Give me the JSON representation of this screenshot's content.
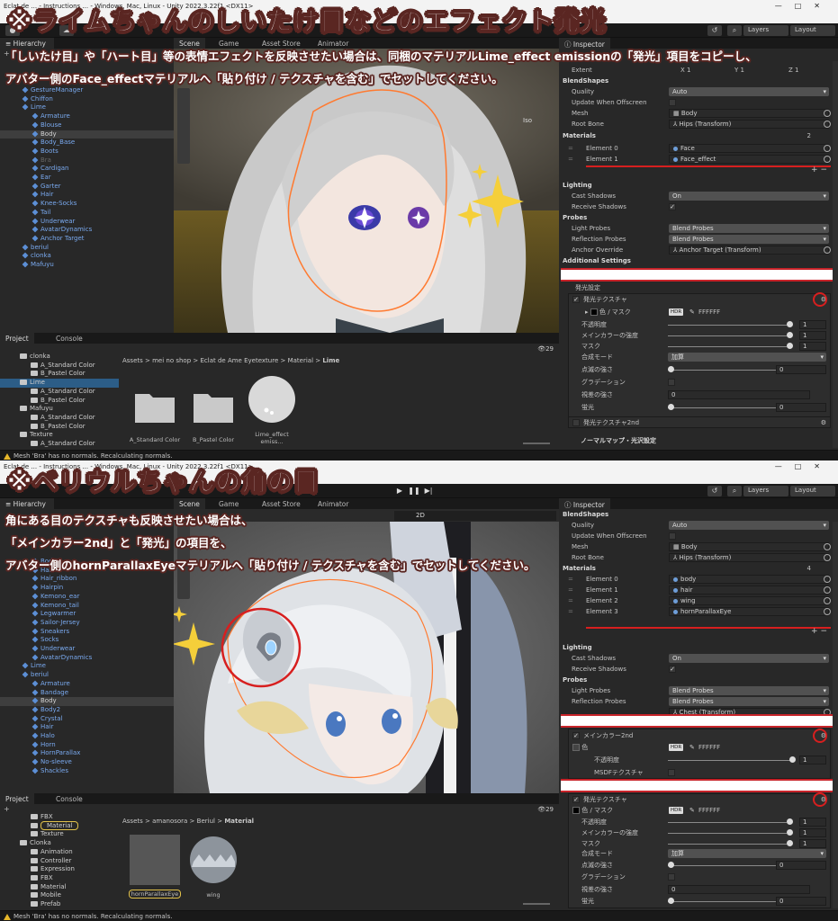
{
  "shot1": {
    "headline": "※ライムちゃんのしいたけ目などのエフェクト発光",
    "note_line1": "「しいたけ目」や「ハート目」等の表情エフェクトを反映させたい場合は、同梱のマテリアルLime_effect emissionの「発光」項目をコピーし、",
    "note_line2": "アバター側のFace_effectマテリアルへ「貼り付け / テクスチャを含む」でセットしてください。",
    "window_title": "Eclat de ... - Instructions ... - Windows, Mac, Linux - Unity 2022.3.22f1 <DX11>",
    "hierarchy": {
      "tab": "Hierarchy",
      "rows": [
        {
          "label": "GestureManager",
          "indent": 1,
          "style": "blue"
        },
        {
          "label": "Chiffon",
          "indent": 1,
          "style": "blue"
        },
        {
          "label": "Lime",
          "indent": 1,
          "style": "blue"
        },
        {
          "label": "Armature",
          "indent": 2,
          "style": "blue"
        },
        {
          "label": "Blouse",
          "indent": 2,
          "style": "blue"
        },
        {
          "label": "Body",
          "indent": 2,
          "style": "blue",
          "selected": true
        },
        {
          "label": "Body_Base",
          "indent": 2,
          "style": "blue"
        },
        {
          "label": "Boots",
          "indent": 2,
          "style": "blue"
        },
        {
          "label": "Bra",
          "indent": 2,
          "style": "gray"
        },
        {
          "label": "Cardigan",
          "indent": 2,
          "style": "blue"
        },
        {
          "label": "Ear",
          "indent": 2,
          "style": "blue"
        },
        {
          "label": "Garter",
          "indent": 2,
          "style": "blue"
        },
        {
          "label": "Hair",
          "indent": 2,
          "style": "blue"
        },
        {
          "label": "Knee-Socks",
          "indent": 2,
          "style": "blue"
        },
        {
          "label": "Tail",
          "indent": 2,
          "style": "blue"
        },
        {
          "label": "Underwear",
          "indent": 2,
          "style": "blue"
        },
        {
          "label": "AvatarDynamics",
          "indent": 2,
          "style": "blue"
        },
        {
          "label": "Anchor Target",
          "indent": 2,
          "style": "blue"
        },
        {
          "label": "beriul",
          "indent": 1,
          "style": "blue"
        },
        {
          "label": "clonka",
          "indent": 1,
          "style": "blue"
        },
        {
          "label": "Mafuyu",
          "indent": 1,
          "style": "blue"
        }
      ]
    },
    "scene_tabs": [
      "Scene",
      "Game",
      "Asset Store",
      "Animator"
    ],
    "scene_persp": "Iso",
    "project": {
      "tabs": [
        "Project",
        "Console"
      ],
      "tree": [
        {
          "label": "clonka",
          "indent": 1
        },
        {
          "label": "A_Standard Color",
          "indent": 2
        },
        {
          "label": "B_Pastel Color",
          "indent": 2
        },
        {
          "label": "Lime",
          "indent": 1,
          "selected": true
        },
        {
          "label": "A_Standard Color",
          "indent": 2
        },
        {
          "label": "B_Pastel Color",
          "indent": 2
        },
        {
          "label": "Mafuyu",
          "indent": 1
        },
        {
          "label": "A_Standard Color",
          "indent": 2
        },
        {
          "label": "B_Pastel Color",
          "indent": 2
        },
        {
          "label": "Texture",
          "indent": 1
        },
        {
          "label": "A_Standard Color",
          "indent": 2
        }
      ],
      "breadcrumb": [
        "Assets",
        "mei no shop",
        "Eclat de Ame Eyetexture",
        "Material",
        "Lime"
      ],
      "assets": [
        "A_Standard Color",
        "B_Pastel Color",
        "Lime_effect emiss..."
      ],
      "count": "29"
    },
    "inspector": {
      "tab": "Inspector",
      "extent_label": "Extent",
      "extent_x": "X  1",
      "extent_y": "Y  1",
      "extent_z": "Z  1",
      "blendshapes": "BlendShapes",
      "quality_label": "Quality",
      "quality_value": "Auto",
      "update_offscreen": "Update When Offscreen",
      "mesh_label": "Mesh",
      "mesh_value": "Body",
      "rootbone_label": "Root Bone",
      "rootbone_value": "Hips (Transform)",
      "materials_label": "Materials",
      "materials_count": "2",
      "elements": [
        {
          "label": "Element 0",
          "value": "Face"
        },
        {
          "label": "Element 1",
          "value": "Face_effect"
        }
      ],
      "lighting": "Lighting",
      "cast_shadows_label": "Cast Shadows",
      "cast_shadows_value": "On",
      "receive_shadows_label": "Receive Shadows",
      "probes": "Probes",
      "light_probes_label": "Light Probes",
      "light_probes_value": "Blend Probes",
      "reflection_probes_label": "Reflection Probes",
      "reflection_probes_value": "Blend Probes",
      "anchor_override_label": "Anchor Override",
      "anchor_override_value": "Anchor Target (Transform)",
      "additional": "Additional Settings",
      "emission_section": "発光設定",
      "emission_tex": "発光テクスチャ",
      "color_mask_label": "色 / マスク",
      "hdr": "HDR",
      "color_hex": "FFFFFF",
      "sliders": [
        {
          "label": "不透明度",
          "value": "1",
          "level": 1
        },
        {
          "label": "メインカラーの強度",
          "value": "1",
          "level": 1
        },
        {
          "label": "マスク",
          "value": "1",
          "level": 1
        }
      ],
      "blend_mode_label": "合成モード",
      "blend_mode_value": "加算",
      "blink_label": "点滅の強さ",
      "blink_value": "0",
      "gradation_label": "グラデーション",
      "parallax_label": "視差の強さ",
      "parallax_value": "0",
      "fluorescence_label": "蛍光",
      "fluorescence_value": "0",
      "emission_tex2": "発光テクスチャ2nd",
      "normalmap": "ノーマルマップ・光沢設定"
    },
    "status": "Mesh 'Bra' has no normals. Recalculating normals.",
    "toolbar_layers": "Layers",
    "toolbar_layout": "Layout"
  },
  "shot2": {
    "headline": "※ベリウルちゃんの角の目",
    "note_line1": "角にある目のテクスチャも反映させたい場合は、",
    "note_line2": "「メインカラー2nd」と「発光」の項目を、",
    "note_line3": "アバター側のhornParallaxEyeマテリアルへ「貼り付け / テクスチャを含む」でセットしてください。",
    "window_title": "Eclat de ... - Instructions ... - Windows, Mac, Linux - Unity 2022.3.22f1 <DX11>",
    "hierarchy": {
      "tab": "Hierarchy",
      "rows": [
        {
          "label": "Body",
          "indent": 2,
          "style": "blue"
        },
        {
          "label": "Hair",
          "indent": 2,
          "style": "blue"
        },
        {
          "label": "Hair_ribbon",
          "indent": 2,
          "style": "blue"
        },
        {
          "label": "Hairpin",
          "indent": 2,
          "style": "blue"
        },
        {
          "label": "Kemono_ear",
          "indent": 2,
          "style": "blue"
        },
        {
          "label": "Kemono_tail",
          "indent": 2,
          "style": "blue"
        },
        {
          "label": "Legwarmer",
          "indent": 2,
          "style": "blue"
        },
        {
          "label": "Sailor-Jersey",
          "indent": 2,
          "style": "blue"
        },
        {
          "label": "Sneakers",
          "indent": 2,
          "style": "blue"
        },
        {
          "label": "Socks",
          "indent": 2,
          "style": "blue"
        },
        {
          "label": "Underwear",
          "indent": 2,
          "style": "blue"
        },
        {
          "label": "AvatarDynamics",
          "indent": 2,
          "style": "blue"
        },
        {
          "label": "Lime",
          "indent": 1,
          "style": "blue"
        },
        {
          "label": "beriul",
          "indent": 1,
          "style": "blue"
        },
        {
          "label": "Armature",
          "indent": 2,
          "style": "blue"
        },
        {
          "label": "Bandage",
          "indent": 2,
          "style": "blue"
        },
        {
          "label": "Body",
          "indent": 2,
          "style": "blue",
          "selected": true
        },
        {
          "label": "Body2",
          "indent": 2,
          "style": "blue"
        },
        {
          "label": "Crystal",
          "indent": 2,
          "style": "blue"
        },
        {
          "label": "Hair",
          "indent": 2,
          "style": "blue"
        },
        {
          "label": "Halo",
          "indent": 2,
          "style": "blue"
        },
        {
          "label": "Horn",
          "indent": 2,
          "style": "blue"
        },
        {
          "label": "HornParallax",
          "indent": 2,
          "style": "blue"
        },
        {
          "label": "No-sleeve",
          "indent": 2,
          "style": "blue"
        },
        {
          "label": "Shackles",
          "indent": 2,
          "style": "blue"
        }
      ]
    },
    "scene_tabs": [
      "Scene",
      "Game",
      "Asset Store",
      "Animator"
    ],
    "scene_2d": "2D",
    "project": {
      "tabs": [
        "Project",
        "Console"
      ],
      "tree": [
        {
          "label": "FBX",
          "indent": 2
        },
        {
          "label": "Material",
          "indent": 2,
          "highlight": true
        },
        {
          "label": "Texture",
          "indent": 2
        },
        {
          "label": "Clonka",
          "indent": 1
        },
        {
          "label": "Animation",
          "indent": 2
        },
        {
          "label": "Controller",
          "indent": 2
        },
        {
          "label": "Expression",
          "indent": 2
        },
        {
          "label": "FBX",
          "indent": 2
        },
        {
          "label": "Material",
          "indent": 2
        },
        {
          "label": "Mobile",
          "indent": 2
        },
        {
          "label": "Prefab",
          "indent": 2
        }
      ],
      "breadcrumb": [
        "Assets",
        "amanosora",
        "Beriul",
        "Material"
      ],
      "assets": [
        "hornParallaxEye",
        "wing"
      ],
      "count": "29"
    },
    "inspector": {
      "tab": "Inspector",
      "blendshapes": "BlendShapes",
      "quality_label": "Quality",
      "quality_value": "Auto",
      "update_offscreen": "Update When Offscreen",
      "mesh_label": "Mesh",
      "mesh_value": "Body",
      "rootbone_label": "Root Bone",
      "rootbone_value": "Hips (Transform)",
      "materials_label": "Materials",
      "materials_count": "4",
      "elements": [
        {
          "label": "Element 0",
          "value": "body"
        },
        {
          "label": "Element 1",
          "value": "hair"
        },
        {
          "label": "Element 2",
          "value": "wing"
        },
        {
          "label": "Element 3",
          "value": "hornParallaxEye"
        }
      ],
      "lighting": "Lighting",
      "cast_shadows_label": "Cast Shadows",
      "cast_shadows_value": "On",
      "receive_shadows_label": "Receive Shadows",
      "probes": "Probes",
      "light_probes_label": "Light Probes",
      "light_probes_value": "Blend Probes",
      "reflection_probes_label": "Reflection Probes",
      "reflection_probes_value": "Blend Probes",
      "anchor_override_value": "Chest (Transform)",
      "maincolor2": "メインカラー2nd",
      "color_label": "色",
      "hdr": "HDR",
      "color_hex": "FFFFFF",
      "opacity_label": "不透明度",
      "opacity_value": "1",
      "msdf_label": "MSDFテクスチャ",
      "emission_tex": "発光テクスチャ",
      "color_mask_label": "色 / マスク",
      "sliders": [
        {
          "label": "不透明度",
          "value": "1",
          "level": 1
        },
        {
          "label": "メインカラーの強度",
          "value": "1",
          "level": 1
        },
        {
          "label": "マスク",
          "value": "1",
          "level": 1
        }
      ],
      "blend_mode_label": "合成モード",
      "blend_mode_value": "加算",
      "blink_label": "点滅の強さ",
      "blink_value": "0",
      "gradation_label": "グラデーション",
      "parallax_label": "視差の強さ",
      "parallax_value": "0",
      "fluorescence_label": "蛍光",
      "fluorescence_value": "0"
    },
    "status": "Mesh 'Bra' has no normals. Recalculating normals.",
    "toolbar_layers": "Layers",
    "toolbar_layout": "Layout"
  },
  "colors": {
    "accent_red": "#d71f1f",
    "headline_outline": "#5a2622",
    "unity_blue_text": "#7aaaf0",
    "selection_blue": "#2c5d87"
  }
}
